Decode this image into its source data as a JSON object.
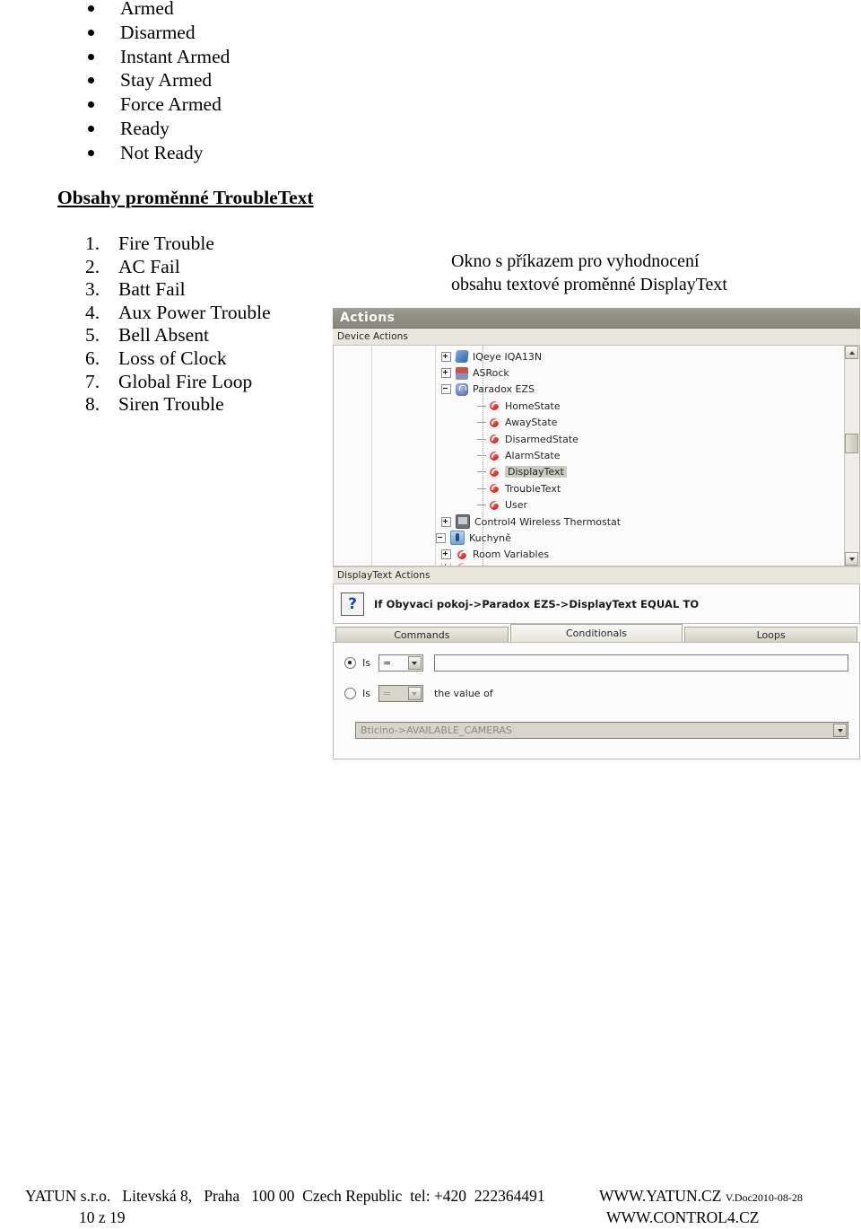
{
  "bullets": [
    "Armed",
    "Disarmed",
    "Instant Armed",
    "Stay Armed",
    "Force Armed",
    "Ready",
    "Not Ready"
  ],
  "heading": "Obsahy proměnné TroubleText",
  "numbered": [
    {
      "num": "1.",
      "label": "Fire Trouble"
    },
    {
      "num": "2.",
      "label": "AC Fail"
    },
    {
      "num": "3.",
      "label": "Batt Fail"
    },
    {
      "num": "4.",
      "label": "Aux Power Trouble"
    },
    {
      "num": "5.",
      "label": "Bell Absent"
    },
    {
      "num": "6.",
      "label": "Loss of Clock"
    },
    {
      "num": "7.",
      "label": "Global Fire Loop"
    },
    {
      "num": "8.",
      "label": "Siren Trouble"
    }
  ],
  "caption": {
    "line1": "Okno s příkazem pro vyhodnocení",
    "line2": "obsahu textové proměnné DisplayText"
  },
  "appshot": {
    "window_title": "Actions",
    "device_actions_label": "Device Actions",
    "tree": [
      {
        "label": "IQeye IQA13N",
        "icon": "camera-icon",
        "toggle": "plus",
        "depth": 0,
        "selected": false
      },
      {
        "label": "ASRock",
        "icon": "motherboard-icon",
        "toggle": "plus",
        "depth": 0,
        "selected": false
      },
      {
        "label": "Paradox EZS",
        "icon": "lock-icon",
        "toggle": "minus",
        "depth": 0,
        "selected": false
      },
      {
        "label": "HomeState",
        "icon": "variable-icon",
        "toggle": "none",
        "depth": 1,
        "selected": false
      },
      {
        "label": "AwayState",
        "icon": "variable-icon",
        "toggle": "none",
        "depth": 1,
        "selected": false
      },
      {
        "label": "DisarmedState",
        "icon": "variable-icon",
        "toggle": "none",
        "depth": 1,
        "selected": false
      },
      {
        "label": "AlarmState",
        "icon": "variable-icon",
        "toggle": "none",
        "depth": 1,
        "selected": false
      },
      {
        "label": "DisplayText",
        "icon": "variable-icon",
        "toggle": "none",
        "depth": 1,
        "selected": true
      },
      {
        "label": "TroubleText",
        "icon": "variable-icon",
        "toggle": "none",
        "depth": 1,
        "selected": false
      },
      {
        "label": "User",
        "icon": "variable-icon",
        "toggle": "none",
        "depth": 1,
        "selected": false
      },
      {
        "label": "Control4 Wireless Thermostat",
        "icon": "screen-icon",
        "toggle": "plus",
        "depth": 0,
        "selected": false
      },
      {
        "label": "Kuchyně",
        "icon": "room-icon",
        "toggle": "minus",
        "depth": -1,
        "selected": false
      },
      {
        "label": "Room Variables",
        "icon": "variable-icon",
        "toggle": "plus",
        "depth": 0,
        "selected": false
      }
    ],
    "display_text_actions_label": "DisplayText Actions",
    "condition_icon": "?",
    "condition_text": "If Obyvaci pokoj->Paradox EZS->DisplayText EQUAL TO",
    "tabs": [
      {
        "label": "Commands",
        "active": false
      },
      {
        "label": "Conditionals",
        "active": true
      },
      {
        "label": "Loops",
        "active": false
      }
    ],
    "conditional": {
      "option1_label": "Is",
      "option1_operator": "=",
      "option1_value": "",
      "option1_selected": true,
      "option2_label": "Is",
      "option2_operator": "=",
      "option2_suffix": "the value of",
      "option2_selected": false,
      "variable_select_value": "Bticino->AVAILABLE_CAMERAS"
    },
    "scrollbar": {
      "up": "▲",
      "down": "▼"
    }
  },
  "footer": {
    "company": "YATUN s.r.o.",
    "street": "Litevská 8,",
    "city": "Praha",
    "zip": "100 00",
    "country": "Czech Republic",
    "tel_label": "tel: +420",
    "tel_number": "222364491",
    "web1": "WWW.YATUN.CZ",
    "version": "V.Doc2010-08-28",
    "web2": "WWW.CONTROL4.CZ",
    "page": "10 z 19"
  }
}
